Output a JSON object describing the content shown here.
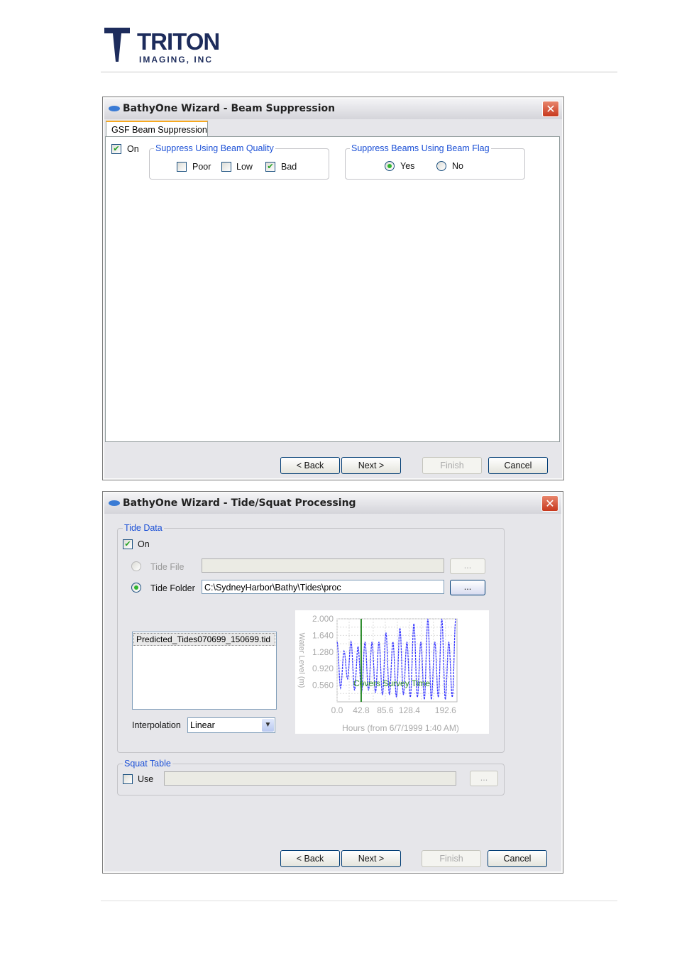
{
  "header": {
    "logo_text": "TRITON",
    "logo_subtext": "IMAGING, INC"
  },
  "dialog1": {
    "title": "BathyOne Wizard - Beam Suppression",
    "tab": "GSF Beam Suppression",
    "on_label": "On",
    "on_checked": true,
    "quality_group": "Suppress Using Beam Quality",
    "quality_options": [
      {
        "label": "Poor",
        "checked": false
      },
      {
        "label": "Low",
        "checked": false
      },
      {
        "label": "Bad",
        "checked": true
      }
    ],
    "flag_group": "Suppress Beams Using Beam Flag",
    "flag_options": [
      {
        "label": "Yes",
        "selected": true
      },
      {
        "label": "No",
        "selected": false
      }
    ],
    "buttons": {
      "back": "< Back",
      "next": "Next >",
      "finish": "Finish",
      "cancel": "Cancel"
    }
  },
  "dialog2": {
    "title": "BathyOne Wizard - Tide/Squat Processing",
    "tide_group": "Tide Data",
    "on_label": "On",
    "on_checked": true,
    "tide_file_label": "Tide File",
    "tide_file_value": "",
    "tide_file_selected": false,
    "tide_folder_label": "Tide Folder",
    "tide_folder_value": "C:\\SydneyHarbor\\Bathy\\Tides\\proc",
    "tide_folder_selected": true,
    "browse_label": "...",
    "files": [
      "Predicted_Tides070699_150699.tid"
    ],
    "interpolation_label": "Interpolation",
    "interpolation_value": "Linear",
    "squat_group": "Squat Table",
    "use_label": "Use",
    "use_checked": false,
    "squat_value": "",
    "buttons": {
      "back": "< Back",
      "next": "Next >",
      "finish": "Finish",
      "cancel": "Cancel"
    }
  },
  "chart_data": {
    "type": "line",
    "xlabel": "Hours (from 6/7/1999 1:40 AM)",
    "ylabel": "Water Level (m)",
    "x_ticks": [
      "0.0",
      "42.8",
      "85.6",
      "128.4",
      "192.6"
    ],
    "y_ticks": [
      "2.000",
      "1.640",
      "1.280",
      "0.920",
      "0.560"
    ],
    "xlim": [
      0,
      213
    ],
    "ylim": [
      0.2,
      2.0
    ],
    "grid": true,
    "annotation": "Covers Survey Time",
    "marker_x": 42.8,
    "series_color": "#3b3bff",
    "marker_color": "#2a8a2a",
    "extrema_interval_hours": 6.2,
    "extrema_values": [
      1.5,
      0.5,
      1.3,
      0.7,
      1.5,
      0.45,
      1.4,
      0.4,
      1.5,
      0.45,
      1.5,
      0.4,
      1.5,
      0.35,
      1.7,
      0.35,
      1.5,
      0.3,
      1.8,
      0.35,
      1.5,
      0.3,
      1.9,
      0.3,
      1.5,
      0.25,
      2.0,
      0.25,
      1.5,
      0.3,
      2.0,
      0.25,
      1.5,
      0.3,
      2.0
    ]
  }
}
